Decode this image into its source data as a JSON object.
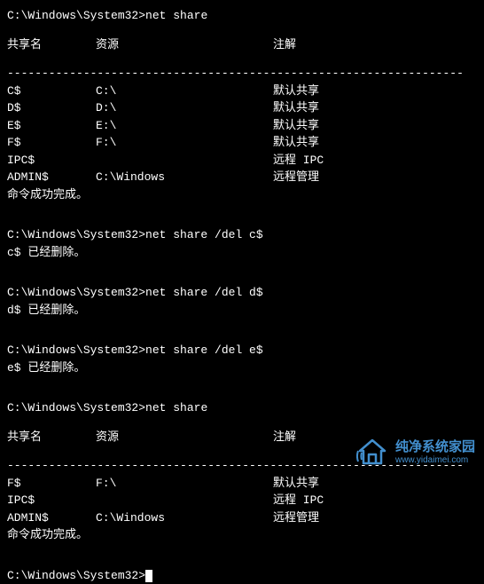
{
  "prompt_path": "C:\\Windows\\System32>",
  "cmd1": "net share",
  "headers": {
    "name": "共享名",
    "resource": "资源",
    "remark": "注解"
  },
  "divider": "------------------------------------------------------------------",
  "shares1": [
    {
      "name": "C$",
      "resource": "C:\\",
      "remark": "默认共享"
    },
    {
      "name": "D$",
      "resource": "D:\\",
      "remark": "默认共享"
    },
    {
      "name": "E$",
      "resource": "E:\\",
      "remark": "默认共享"
    },
    {
      "name": "F$",
      "resource": "F:\\",
      "remark": "默认共享"
    },
    {
      "name": "IPC$",
      "resource": "",
      "remark": "远程 IPC"
    },
    {
      "name": "ADMIN$",
      "resource": "C:\\Windows",
      "remark": "远程管理"
    }
  ],
  "success": "命令成功完成。",
  "del_cmds": [
    {
      "cmd": "net share /del c$",
      "out": "c$ 已经删除。"
    },
    {
      "cmd": "net share /del d$",
      "out": "d$ 已经删除。"
    },
    {
      "cmd": "net share /del e$",
      "out": "e$ 已经删除。"
    }
  ],
  "cmd2": "net share",
  "shares2": [
    {
      "name": "F$",
      "resource": "F:\\",
      "remark": "默认共享"
    },
    {
      "name": "IPC$",
      "resource": "",
      "remark": "远程 IPC"
    },
    {
      "name": "ADMIN$",
      "resource": "C:\\Windows",
      "remark": "远程管理"
    }
  ],
  "watermark": {
    "title": "纯净系统家园",
    "url": "www.yidaimei.com"
  }
}
